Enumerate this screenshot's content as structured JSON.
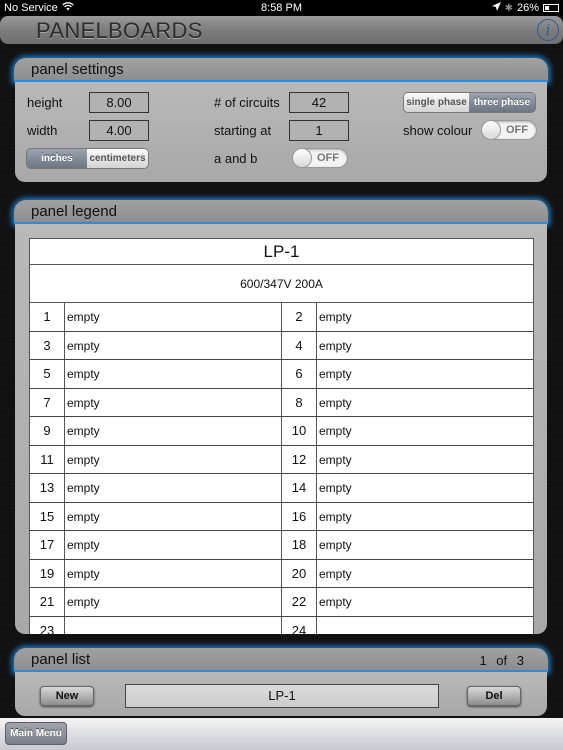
{
  "status_bar": {
    "carrier": "No Service",
    "time": "8:58 PM",
    "battery": "26%"
  },
  "app": {
    "title": "PANELBOARDS",
    "info_label": "i"
  },
  "settings": {
    "header": "panel settings",
    "height_label": "height",
    "height_value": "8.00",
    "width_label": "width",
    "width_value": "4.00",
    "units": {
      "options": [
        "inches",
        "centimeters"
      ],
      "selected": "inches"
    },
    "circuits_label": "# of circuits",
    "circuits_value": "42",
    "starting_label": "starting at",
    "starting_value": "1",
    "ab_label": "a and b",
    "ab_toggle": "OFF",
    "phase": {
      "options": [
        "single phase",
        "three phase"
      ],
      "selected": "three phase"
    },
    "colour_label": "show colour",
    "colour_toggle": "OFF"
  },
  "legend": {
    "header": "panel legend",
    "panel_name": "LP-1",
    "panel_rating": "600/347V 200A",
    "rows": [
      {
        "left_num": "1",
        "left_desc": "empty",
        "right_num": "2",
        "right_desc": "empty"
      },
      {
        "left_num": "3",
        "left_desc": "empty",
        "right_num": "4",
        "right_desc": "empty"
      },
      {
        "left_num": "5",
        "left_desc": "empty",
        "right_num": "6",
        "right_desc": "empty"
      },
      {
        "left_num": "7",
        "left_desc": "empty",
        "right_num": "8",
        "right_desc": "empty"
      },
      {
        "left_num": "9",
        "left_desc": "empty",
        "right_num": "10",
        "right_desc": "empty"
      },
      {
        "left_num": "11",
        "left_desc": "empty",
        "right_num": "12",
        "right_desc": "empty"
      },
      {
        "left_num": "13",
        "left_desc": "empty",
        "right_num": "14",
        "right_desc": "empty"
      },
      {
        "left_num": "15",
        "left_desc": "empty",
        "right_num": "16",
        "right_desc": "empty"
      },
      {
        "left_num": "17",
        "left_desc": "empty",
        "right_num": "18",
        "right_desc": "empty"
      },
      {
        "left_num": "19",
        "left_desc": "empty",
        "right_num": "20",
        "right_desc": "empty"
      },
      {
        "left_num": "21",
        "left_desc": "empty",
        "right_num": "22",
        "right_desc": "empty"
      },
      {
        "left_num": "23",
        "left_desc": "",
        "right_num": "24",
        "right_desc": ""
      }
    ]
  },
  "panel_list": {
    "header": "panel list",
    "current": "1",
    "of_label": "of",
    "total": "3",
    "new_label": "New",
    "selected_panel": "LP-1",
    "del_label": "Del"
  },
  "toolbar": {
    "main_menu_label": "Main Menu"
  },
  "colors": {
    "glow_accent": "#1e7fd0",
    "info_icon": "#2a5a9a"
  }
}
